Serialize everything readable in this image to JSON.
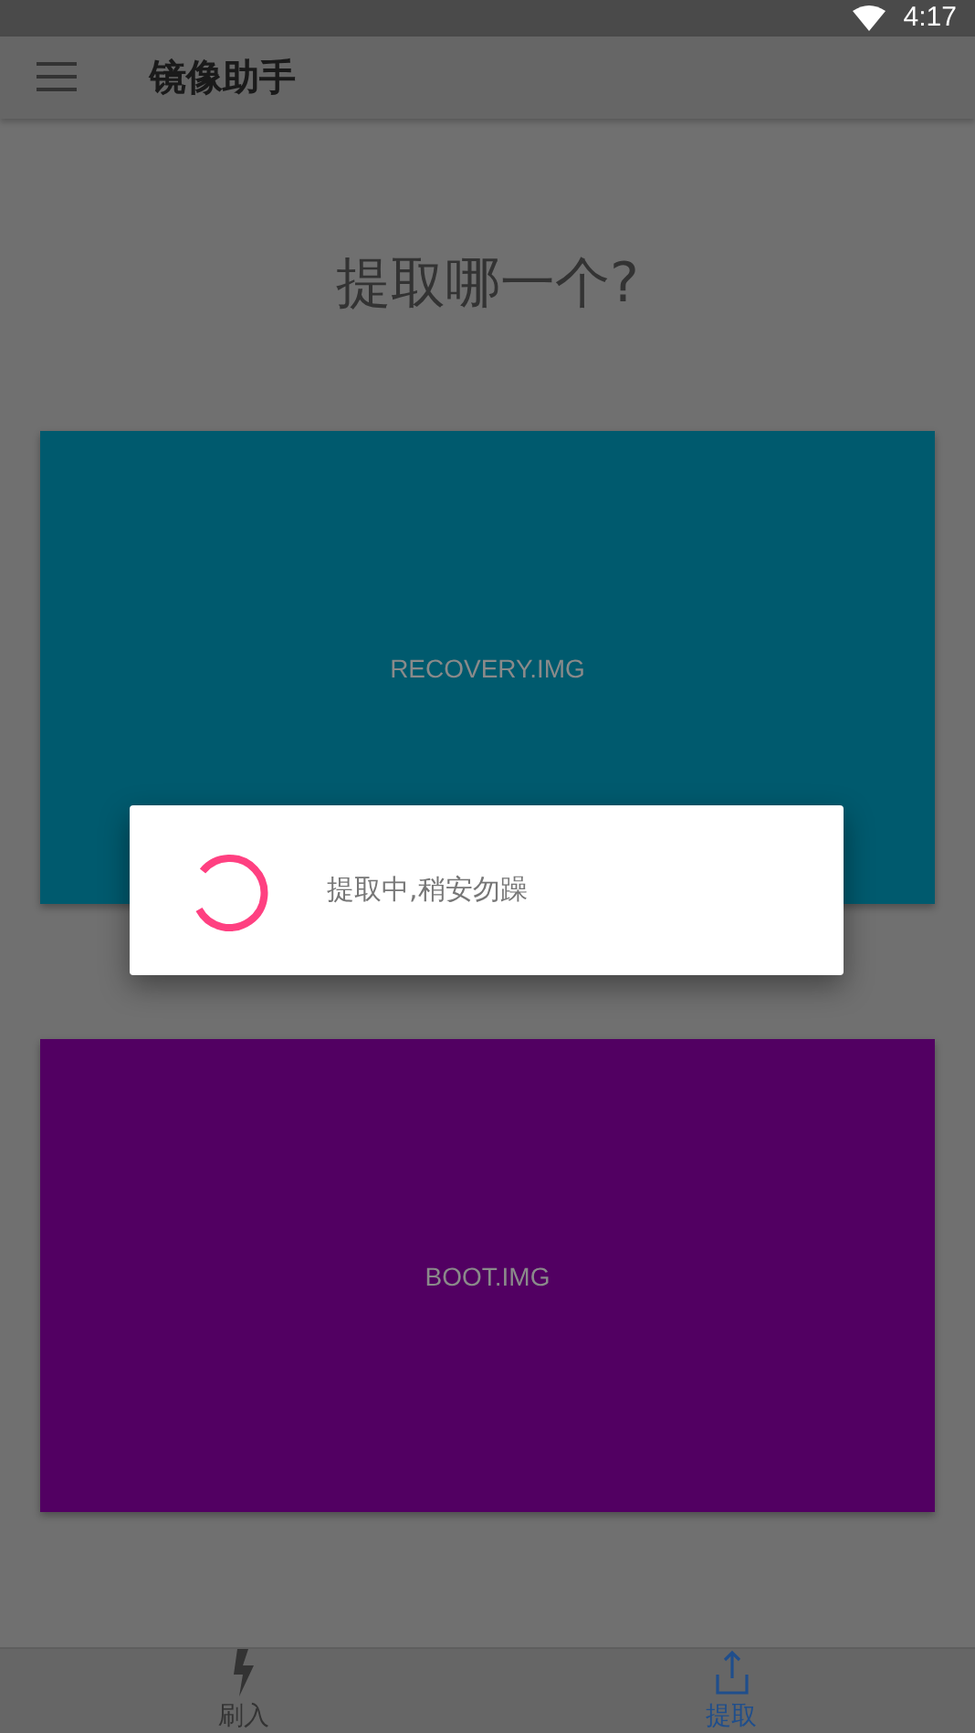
{
  "status_bar": {
    "time": "4:17"
  },
  "app_bar": {
    "title": "镜像助手"
  },
  "heading": "提取哪一个?",
  "images": [
    {
      "label": "RECOVERY.IMG",
      "color": "#005a6e"
    },
    {
      "label": "BOOT.IMG",
      "color": "#520062"
    }
  ],
  "dialog": {
    "message": "提取中,稍安勿躁"
  },
  "bottom_nav": [
    {
      "label": "刷入",
      "kind": "flash",
      "selected": false
    },
    {
      "label": "提取",
      "kind": "extract",
      "selected": true
    }
  ]
}
